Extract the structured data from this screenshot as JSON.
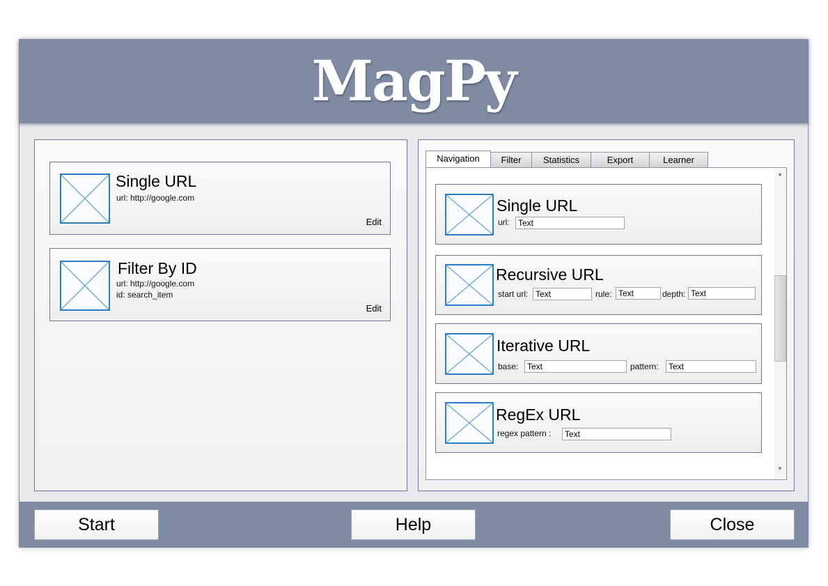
{
  "app": {
    "title": "MagPy"
  },
  "left": {
    "cards": [
      {
        "title": "Single URL",
        "lines": [
          "url: http://google.com"
        ],
        "edit": "Edit"
      },
      {
        "title": "Filter By ID",
        "lines": [
          "url: http://google.com",
          "id: search_item"
        ],
        "edit": "Edit"
      }
    ]
  },
  "tabs": [
    {
      "label": "Navigation",
      "active": true
    },
    {
      "label": "Filter"
    },
    {
      "label": "Statistics"
    },
    {
      "label": "Export"
    },
    {
      "label": "Learner"
    }
  ],
  "nav": {
    "single": {
      "title": "Single URL",
      "url_label": "url:",
      "url_value": "Text"
    },
    "recursive": {
      "title": "Recursive URL",
      "start_label": "start url:",
      "start_value": "Text",
      "rule_label": "rule:",
      "rule_value": "Text",
      "depth_label": "depth:",
      "depth_value": "Text"
    },
    "iterative": {
      "title": "Iterative URL",
      "base_label": "base:",
      "base_value": "Text",
      "pattern_label": "pattern:",
      "pattern_value": "Text"
    },
    "regex": {
      "title": "RegEx URL",
      "pattern_label": "regex pattern :",
      "pattern_value": "Text"
    }
  },
  "footer": {
    "start": "Start",
    "help": "Help",
    "close": "Close"
  },
  "colors": {
    "header": "#7f8ba3",
    "body": "#e8e9ee",
    "placeholder_stroke": "#2a7fc8"
  }
}
